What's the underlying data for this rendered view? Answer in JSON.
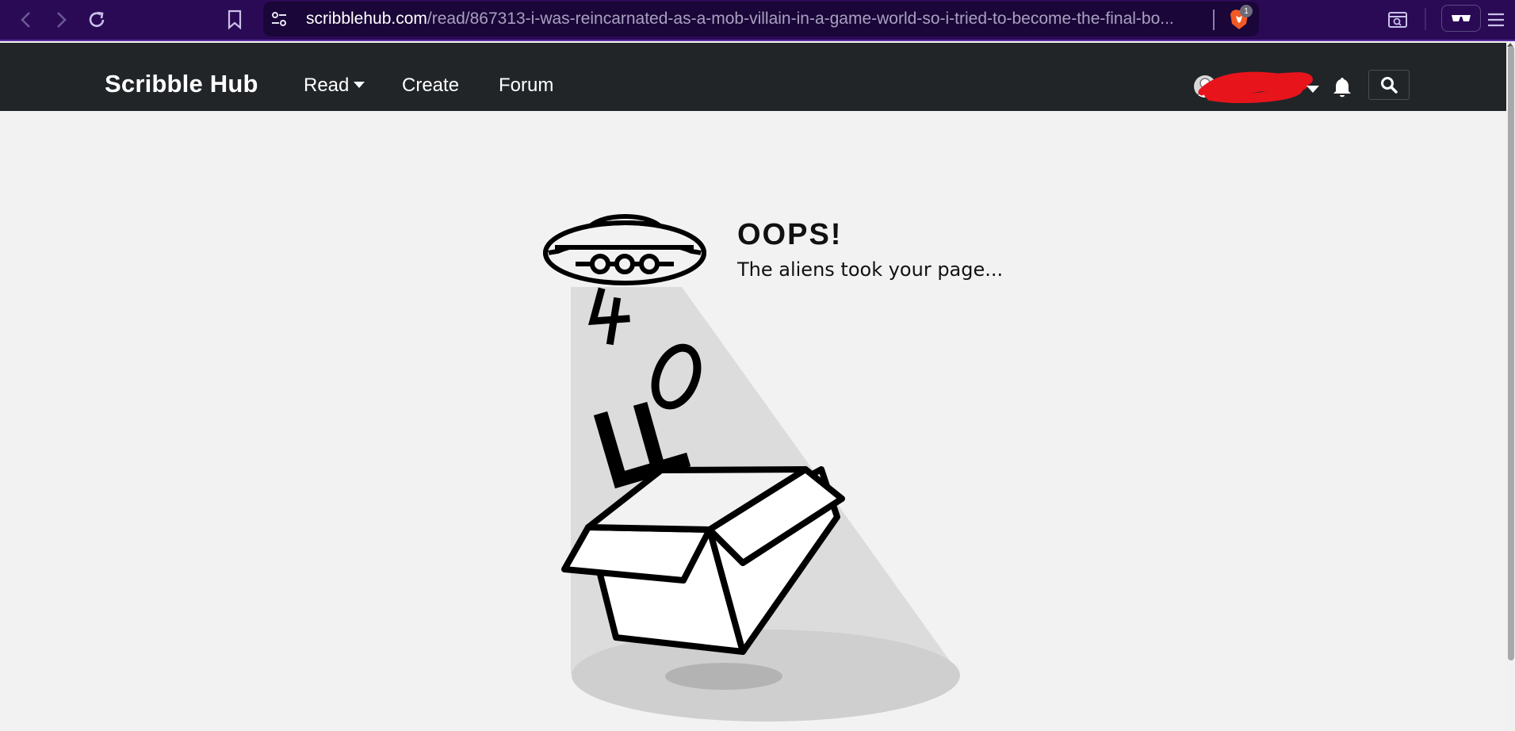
{
  "browser": {
    "url_host": "scribblehub.com",
    "url_path": "/read/867313-i-was-reincarnated-as-a-mob-villain-in-a-game-world-so-i-tried-to-become-the-final-bo...",
    "shield_count": "1",
    "icons": [
      "back-icon",
      "forward-icon",
      "reload-icon",
      "bookmark-icon",
      "site-settings-icon",
      "brave-shield-icon",
      "search-tab-icon",
      "reader-mode-icon",
      "menu-icon"
    ]
  },
  "header": {
    "logo": "Scribble Hub",
    "nav": {
      "read": "Read",
      "create": "Create",
      "forum": "Forum"
    }
  },
  "error": {
    "title": "OOPS!",
    "subtitle": "The aliens took your page...",
    "code_digits": [
      "4",
      "0",
      "4"
    ]
  },
  "colors": {
    "browser_bg": "#2a0a55",
    "header_bg": "#212528",
    "page_bg": "#f2f2f2",
    "beam": "#dcdcdc",
    "redaction": "#e8141c"
  }
}
